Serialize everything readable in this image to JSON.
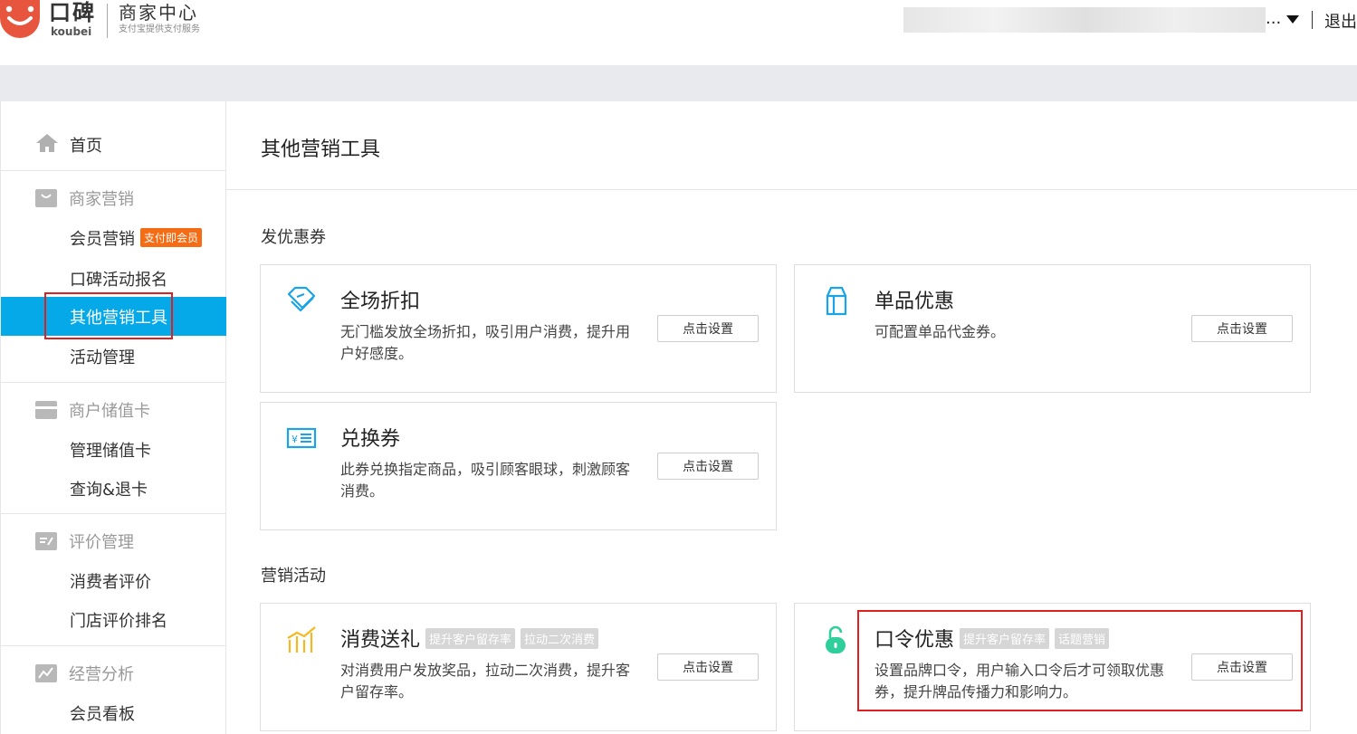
{
  "header": {
    "brand_cn": "口碑",
    "brand_en": "koubei",
    "portal_title": "商家中心",
    "portal_desc": "支付宝提供支付服务",
    "user_ellipsis": "...",
    "logout_label": "退出"
  },
  "sidebar": {
    "home_label": "首页",
    "groups": [
      {
        "title": "商家营销",
        "items": [
          {
            "label": "会员营销",
            "badge": "支付即会员"
          },
          {
            "label": "口碑活动报名"
          },
          {
            "label": "其他营销工具"
          },
          {
            "label": "活动管理"
          }
        ]
      },
      {
        "title": "商户储值卡",
        "items": [
          {
            "label": "管理储值卡"
          },
          {
            "label": "查询&退卡"
          }
        ]
      },
      {
        "title": "评价管理",
        "items": [
          {
            "label": "消费者评价"
          },
          {
            "label": "门店评价排名"
          }
        ]
      },
      {
        "title": "经营分析",
        "items": [
          {
            "label": "会员看板"
          }
        ]
      }
    ]
  },
  "main": {
    "page_title": "其他营销工具",
    "sections": [
      {
        "title": "发优惠券",
        "cards": [
          {
            "title": "全场折扣",
            "desc": "无门槛发放全场折扣，吸引用户消费，提升用户好感度。",
            "button": "点击设置",
            "icon": "discount-tag-icon"
          },
          {
            "title": "单品优惠",
            "desc": "可配置单品代金券。",
            "button": "点击设置",
            "icon": "milk-box-icon"
          },
          {
            "title": "兑换券",
            "desc": "此券兑换指定商品，吸引顾客眼球，刺激顾客消费。",
            "button": "点击设置",
            "icon": "voucher-icon"
          }
        ]
      },
      {
        "title": "营销活动",
        "cards": [
          {
            "title": "消费送礼",
            "tags": [
              "提升客户留存率",
              "拉动二次消费"
            ],
            "desc": "对消费用户发放奖品，拉动二次消费，提升客户留存率。",
            "button": "点击设置",
            "icon": "bar-chart-icon"
          },
          {
            "title": "口令优惠",
            "tags": [
              "提升客户留存率",
              "话题营销"
            ],
            "desc": "设置品牌口令，用户输入口令后才可领取优惠券，提升牌品传播力和影响力。",
            "button": "点击设置",
            "icon": "unlock-icon"
          }
        ]
      }
    ]
  },
  "colors": {
    "brand_red": "#e8553e",
    "active_blue": "#06a9e8",
    "badge_orange": "#f56c15",
    "highlight_red": "#e02020",
    "unlock_green": "#2ecf9a",
    "gold": "#f5b820"
  }
}
